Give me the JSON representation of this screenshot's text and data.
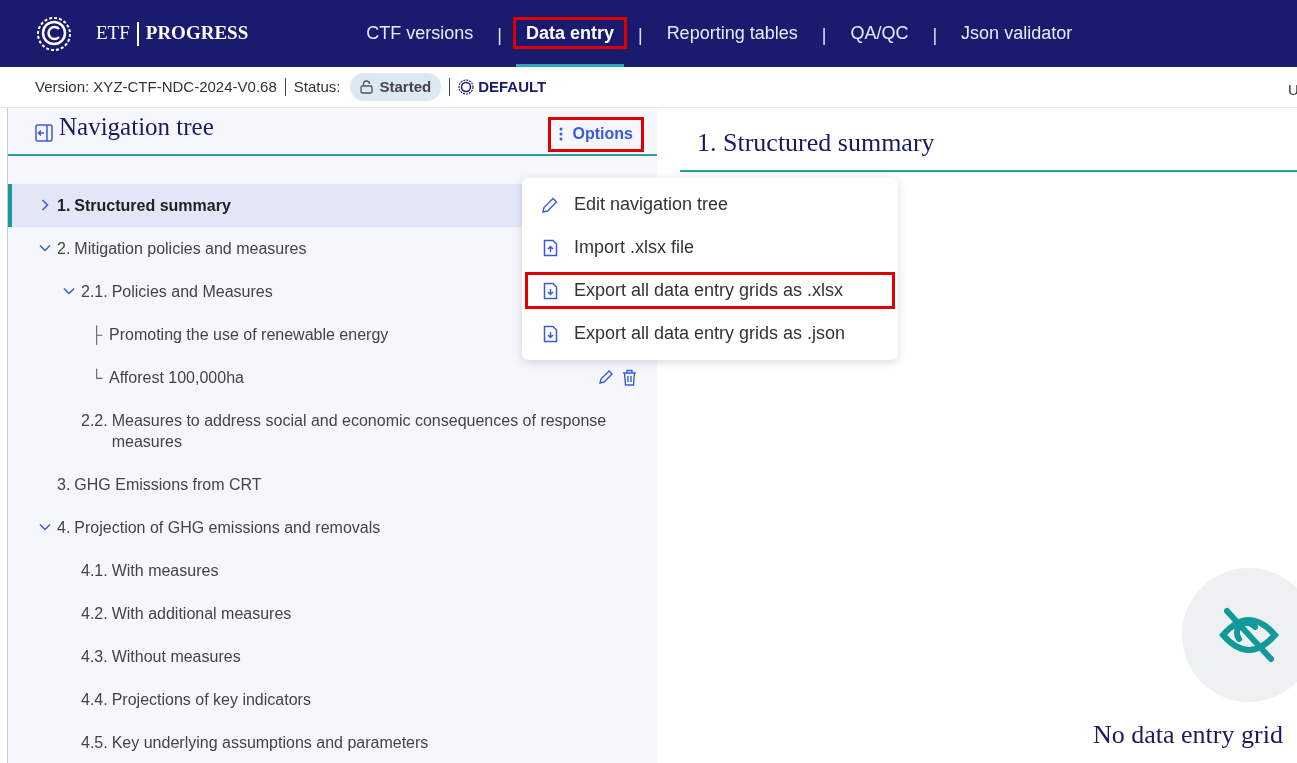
{
  "app": {
    "brand_left": "ETF",
    "brand_right": "PROGRESS"
  },
  "nav": [
    {
      "kind": "tab",
      "label": "CTF versions",
      "selected": false,
      "highlighted": false
    },
    {
      "kind": "separator",
      "label": "|"
    },
    {
      "kind": "tab",
      "label": "Data entry",
      "selected": true,
      "highlighted": true
    },
    {
      "kind": "separator",
      "label": "|"
    },
    {
      "kind": "tab",
      "label": "Reporting tables",
      "selected": false,
      "highlighted": false
    },
    {
      "kind": "separator",
      "label": "|"
    },
    {
      "kind": "tab",
      "label": "QA/QC",
      "selected": false,
      "highlighted": false
    },
    {
      "kind": "separator",
      "label": "|"
    },
    {
      "kind": "tab",
      "label": "Json validator",
      "selected": false,
      "highlighted": false
    }
  ],
  "status_bar": {
    "version": "Version: XYZ-CTF-NDC-2024-V0.68",
    "status_label": "Status:",
    "status": "Started",
    "scope": "DEFAULT",
    "cut_text": "U"
  },
  "navigation_tree": {
    "title": "Navigation tree",
    "options_button": {
      "label": "Options",
      "highlighted": true
    },
    "items": [
      {
        "kind": "node",
        "number": "1.",
        "label": "Structured summary",
        "selected": true,
        "expanded": false
      },
      {
        "kind": "node",
        "number": "2.",
        "label": "Mitigation policies and measures",
        "selected": false,
        "expanded": true,
        "children": [
          {
            "kind": "node",
            "number": "2.1.",
            "label": "Policies and Measures",
            "selected": false,
            "expanded": true,
            "children": [
              {
                "kind": "leaf",
                "connector": "├",
                "label": "Promoting the use of renewable energy",
                "selected": false
              },
              {
                "kind": "leaf",
                "connector": "└",
                "label": "Afforest 100,000ha",
                "selected": false,
                "actions": true
              }
            ]
          },
          {
            "kind": "node",
            "number": "2.2.",
            "label": "Measures to address social and economic consequences of response measures",
            "selected": false
          }
        ]
      },
      {
        "kind": "node",
        "number": "3.",
        "label": "GHG Emissions from CRT",
        "selected": false
      },
      {
        "kind": "node",
        "number": "4.",
        "label": "Projection of GHG emissions and removals",
        "selected": false,
        "expanded": true,
        "children": [
          {
            "kind": "node",
            "number": "4.1.",
            "label": "With measures",
            "selected": false
          },
          {
            "kind": "node",
            "number": "4.2.",
            "label": "With additional measures",
            "selected": false
          },
          {
            "kind": "node",
            "number": "4.3.",
            "label": "Without measures",
            "selected": false
          },
          {
            "kind": "node",
            "number": "4.4.",
            "label": "Projections of key indicators",
            "selected": false
          },
          {
            "kind": "node",
            "number": "4.5.",
            "label": "Key underlying assumptions and parameters",
            "selected": false
          }
        ]
      }
    ]
  },
  "options_menu": [
    {
      "kind": "edit",
      "label": "Edit navigation tree",
      "highlighted": false
    },
    {
      "kind": "import",
      "label": "Import .xlsx file",
      "highlighted": false
    },
    {
      "kind": "export",
      "label": "Export all data entry grids as .xlsx",
      "highlighted": true
    },
    {
      "kind": "export",
      "label": "Export all data entry grids as .json",
      "highlighted": false
    }
  ],
  "content": {
    "title": "1. Structured summary",
    "empty_message": "No data entry grid"
  }
}
